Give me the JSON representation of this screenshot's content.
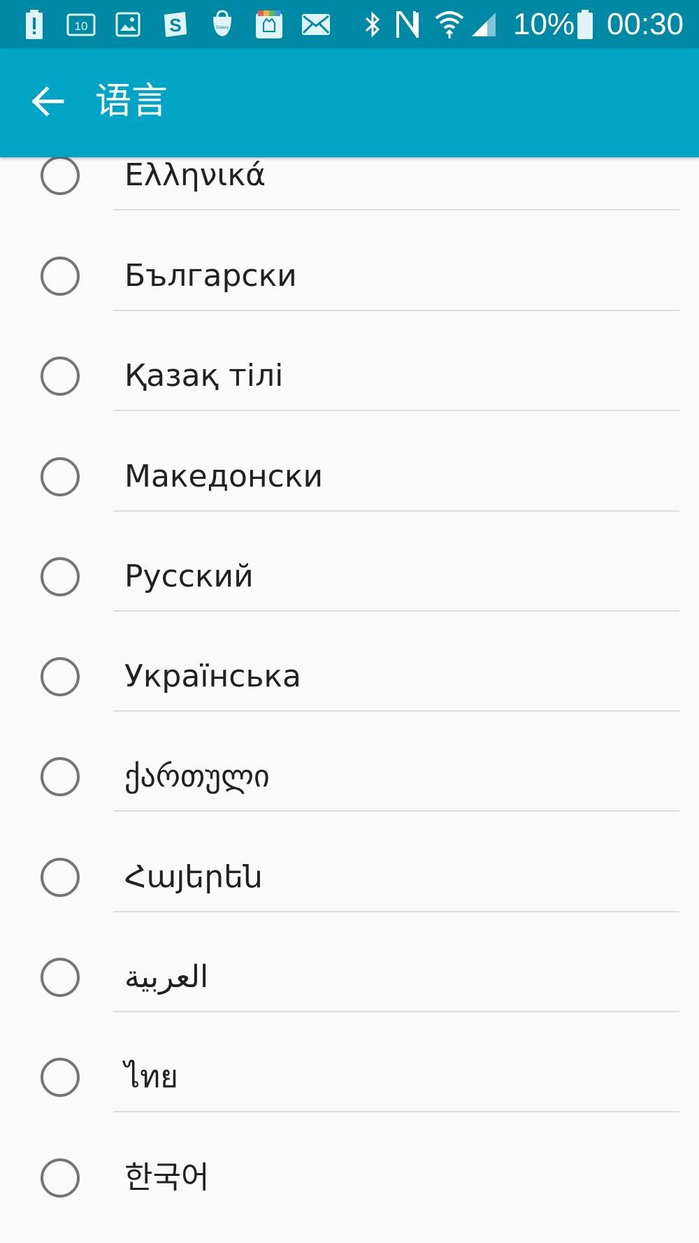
{
  "status_bar": {
    "notification_icons": [
      "battery-alert-icon",
      "calendar-10-icon",
      "gallery-icon",
      "s-app-icon",
      "galaxy-apps-icon",
      "store-icon",
      "mail-icon"
    ],
    "calendar_day": "10",
    "galaxy_label": "Galaxy",
    "system_icons": [
      "bluetooth-icon",
      "nfc-icon",
      "wifi-icon",
      "signal-icon"
    ],
    "battery_percent": "10%",
    "time": "00:30"
  },
  "app_bar": {
    "title": "语言"
  },
  "languages": [
    {
      "label": "Ελληνικά",
      "selected": false
    },
    {
      "label": "Български",
      "selected": false
    },
    {
      "label": "Қазақ тілі",
      "selected": false
    },
    {
      "label": "Македонски",
      "selected": false
    },
    {
      "label": "Русский",
      "selected": false
    },
    {
      "label": "Українська",
      "selected": false
    },
    {
      "label": "ქართული",
      "selected": false
    },
    {
      "label": "Հայերեն",
      "selected": false
    },
    {
      "label": "العربية",
      "selected": false
    },
    {
      "label": "ไทย",
      "selected": false
    },
    {
      "label": "한국어",
      "selected": false
    }
  ],
  "colors": {
    "status_bar": "#0089a4",
    "app_bar": "#00a5c6",
    "background": "#fafafa",
    "text": "#212121",
    "radio": "#757575"
  }
}
